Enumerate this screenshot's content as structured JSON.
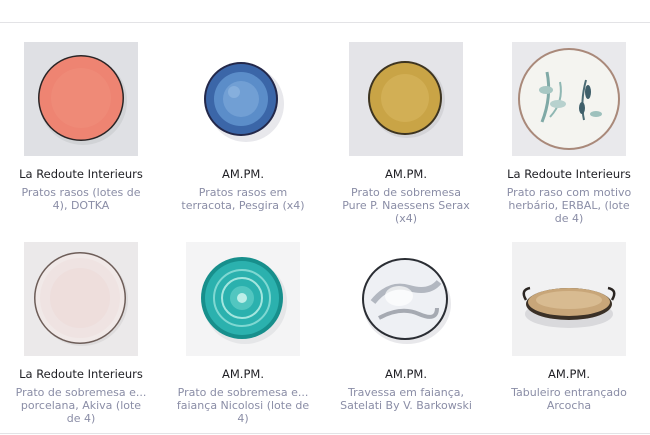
{
  "products": [
    {
      "brand": "La Redoute Interieurs",
      "title": "Pratos rasos (lotes de 4), DOTKA",
      "image": "coral-plate"
    },
    {
      "brand": "AM.PM.",
      "title": "Pratos rasos em terracota, Pesgira (x4)",
      "image": "blue-glazed-plate"
    },
    {
      "brand": "AM.PM.",
      "title": "Prato de sobremesa Pure P. Naessens Serax (x4)",
      "image": "mustard-plate"
    },
    {
      "brand": "La Redoute Interieurs",
      "title": "Prato raso com motivo herbário, ERBAL, (lote de 4)",
      "image": "herbal-plate"
    },
    {
      "brand": "La Redoute Interieurs",
      "title": "Prato de sobremesa e... porcelana, Akiva (lote de 4)",
      "image": "dotted-white-plate"
    },
    {
      "brand": "AM.PM.",
      "title": "Prato de sobremesa e... faiança Nicolosi (lote de 4)",
      "image": "turquoise-mandala-plate"
    },
    {
      "brand": "AM.PM.",
      "title": "Travessa em faiança, Satelati By V. Barkowski",
      "image": "marbled-platter"
    },
    {
      "brand": "AM.PM.",
      "title": "Tabuleiro entrançado Arcocha",
      "image": "woven-tray"
    }
  ]
}
